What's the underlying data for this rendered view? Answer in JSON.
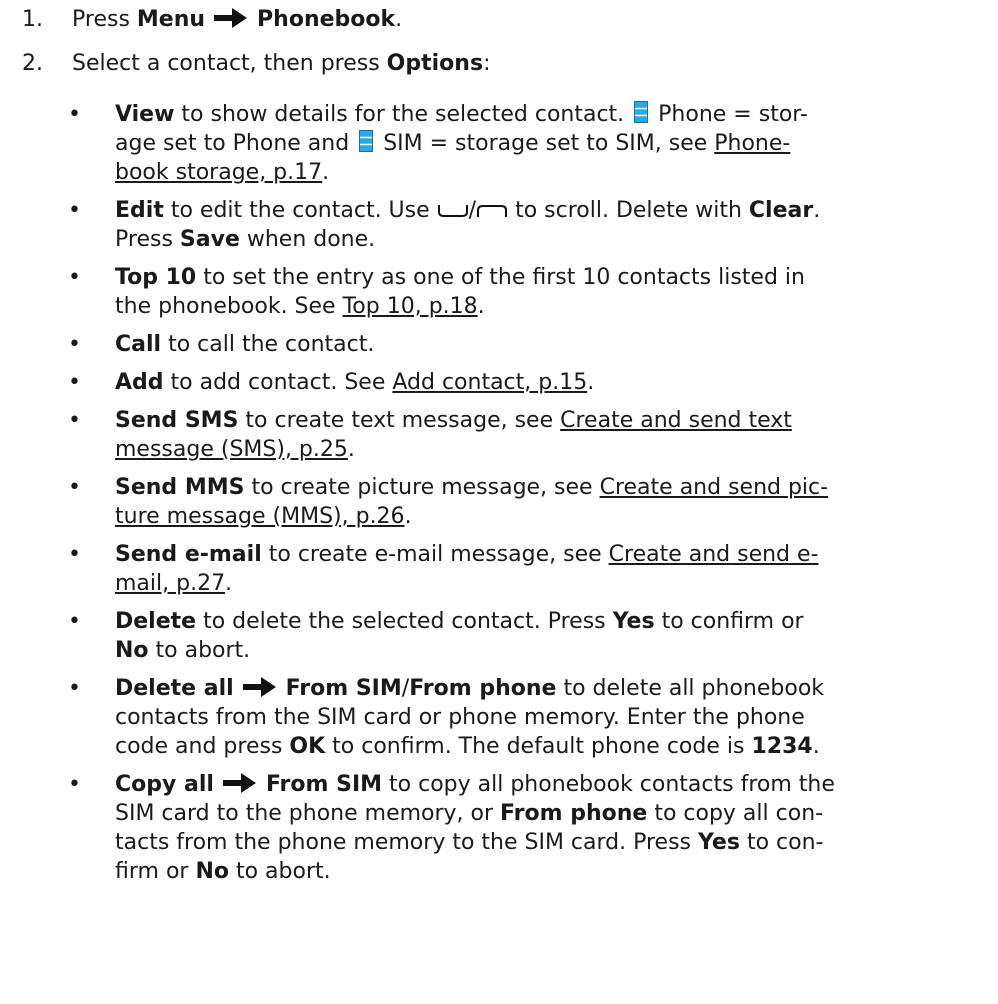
{
  "steps": [
    {
      "num": "1.",
      "pre": "Press ",
      "b1": "Menu",
      "icon": "right-arrow-icon",
      "b2": "Phonebook",
      "post": "."
    },
    {
      "num": "2.",
      "pre": "Select a contact, then press ",
      "b1": "Options",
      "post": ":"
    }
  ],
  "bullet": "•",
  "items": {
    "view": {
      "b": "View",
      "l1": " to show details for the selected contact. ",
      "l1b": " Phone = stor-",
      "l2a": "age set to Phone and ",
      "l2b": " SIM = storage set to SIM, see ",
      "link1": "Phone-",
      "link2": "book storage, p.17",
      "end": ".",
      "icon": "phone-storage-icon",
      "icon2": "sim-storage-icon",
      "icon_color": "#29a9e6"
    },
    "edit": {
      "b": "Edit",
      "l1": " to edit the contact. Use ",
      "icon1": "scroll-down-key-icon",
      "slash": "/",
      "icon2": "scroll-up-key-icon",
      "l1b": " to scroll. Delete with ",
      "b2": "Clear",
      "p1": ".",
      "l2a": "Press ",
      "b3": "Save",
      "l2b": " when done."
    },
    "top10": {
      "b": "Top 10",
      "l1": " to set the entry as one of the first 10 contacts listed in",
      "l2": "the phonebook. See ",
      "link": "Top 10, p.18",
      "end": "."
    },
    "call": {
      "b": "Call",
      "l1": " to call the contact."
    },
    "add": {
      "b": "Add",
      "l1": " to add contact. See ",
      "link": "Add contact, p.15",
      "end": "."
    },
    "sms": {
      "b": "Send SMS",
      "l1": " to create text message, see ",
      "link1": "Create and send text",
      "link2": "message (SMS), p.25",
      "end": "."
    },
    "mms": {
      "b": "Send MMS",
      "l1": " to create picture message, see ",
      "link1": "Create and send pic-",
      "link2": "ture message (MMS), p.26",
      "end": "."
    },
    "email": {
      "b": "Send e-mail",
      "l1": " to create e-mail message, see ",
      "link1": "Create and send e-",
      "link2": "mail, p.27",
      "end": "."
    },
    "delete": {
      "b": "Delete",
      "l1": " to delete the selected contact. Press ",
      "b2": "Yes",
      "l1b": " to confirm or",
      "b3": "No",
      "l2": " to abort."
    },
    "deleteall": {
      "b": "Delete all",
      "icon": "right-arrow-icon",
      "b2": "From SIM",
      "slash": "/",
      "b3": "From phone",
      "l1": " to delete all phonebook",
      "l2": "contacts from the SIM card or phone memory. Enter the phone",
      "l3a": "code and press ",
      "b4": "OK",
      "l3b": " to confirm. The default phone code is ",
      "b5": "1234",
      "end": "."
    },
    "copyall": {
      "b": "Copy all",
      "icon": "right-arrow-icon",
      "b2": "From SIM",
      "l1": " to copy all phonebook contacts from the",
      "l2a": "SIM card to the phone memory, or ",
      "b3": "From phone",
      "l2b": " to copy all con-",
      "l3a": "tacts from the phone memory to the SIM card. Press ",
      "b4": "Yes",
      "l3b": " to con-",
      "l4a": "firm or ",
      "b5": "No",
      "l4b": " to abort."
    }
  }
}
